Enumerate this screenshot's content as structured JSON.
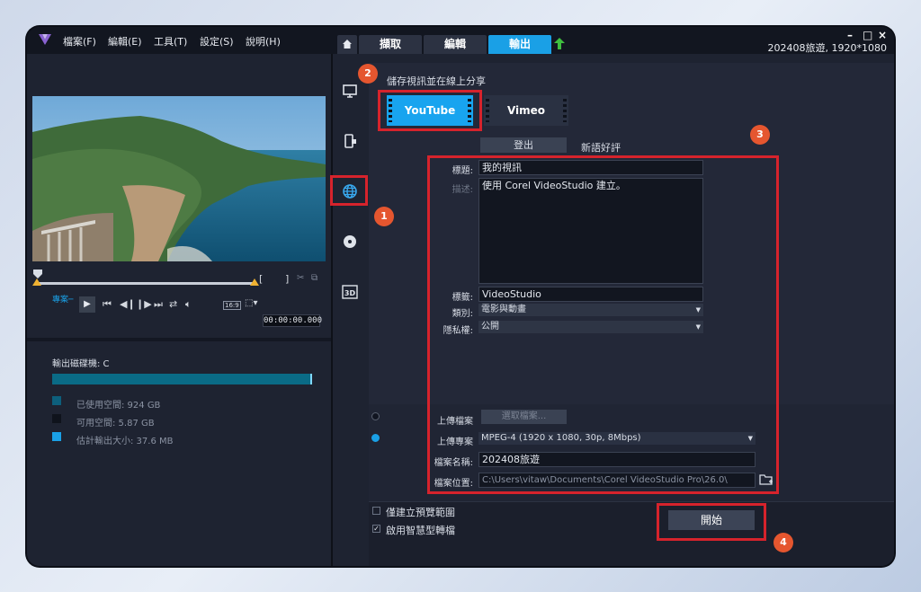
{
  "menu": [
    "檔案(F)",
    "編輯(E)",
    "工具(T)",
    "設定(S)",
    "說明(H)"
  ],
  "tabs": {
    "capture": "擷取",
    "edit": "編輯",
    "share": "輸出"
  },
  "window": {
    "minimize": "–",
    "maximize": "□",
    "close": "×",
    "title": "202408旅遊, 1920*1080"
  },
  "player": {
    "project_label": "專案─",
    "play": "▶",
    "aspect": "16:9",
    "timecode": "00:00:00.000",
    "trim_in": "[",
    "trim_out": "]",
    "progress": 0
  },
  "disk": {
    "label": "輸出磁碟機: C",
    "used": "已使用空間: 924 GB",
    "free": "可用空間: 5.87 GB",
    "estimate": "估計輸出大小: 37.6 MB",
    "colors": {
      "used": "#0d5f7c",
      "free": "#0f131c",
      "estimate": "#1aa0e6"
    }
  },
  "share": {
    "section_title": "儲存視訊並在線上分享",
    "youtube": "YouTube",
    "vimeo": "Vimeo",
    "logout": "登出",
    "subscribe": "新語好評"
  },
  "form": {
    "title_label": "標題:",
    "title_value": "我的視訊",
    "desc_label": "描述:",
    "desc_value": "使用 Corel VideoStudio 建立。",
    "tags_label": "標籤:",
    "tags_value": "VideoStudio",
    "category_label": "類別:",
    "category_value": "電影與動畫",
    "privacy_label": "隱私權:",
    "privacy_value": "公開",
    "upload_file_label": "上傳檔案",
    "choose_file": "選取檔案...",
    "upload_project_label": "上傳專案",
    "format_value": "MPEG-4 (1920 x 1080, 30p, 8Mbps)",
    "filename_label": "檔案名稱:",
    "filename_value": "202408旅遊",
    "location_label": "檔案位置:",
    "location_value": "C:\\Users\\vitaw\\Documents\\Corel VideoStudio Pro\\26.0\\"
  },
  "options": {
    "preview_only": "僅建立預覽範圍",
    "smart_render": "啟用智慧型轉檔",
    "smart_render_checked": true
  },
  "start": "開始",
  "badges": [
    "1",
    "2",
    "3",
    "4"
  ],
  "colors": {
    "accent": "#1aa0e6",
    "highlight": "#d6232c",
    "badge": "#e5562f"
  }
}
